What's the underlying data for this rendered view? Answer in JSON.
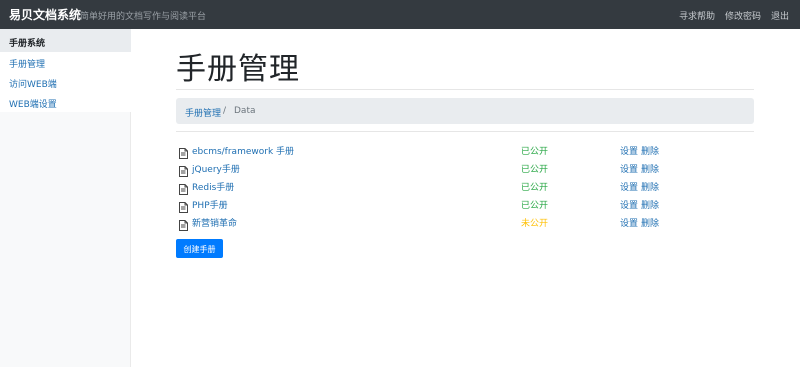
{
  "header": {
    "brand": "易贝文档系统",
    "tagline": "简单好用的文档写作与阅读平台",
    "nav": [
      "寻求帮助",
      "修改密码",
      "退出"
    ]
  },
  "sidebar": {
    "title": "手册系统",
    "items": [
      {
        "label": "手册管理"
      },
      {
        "label": "访问WEB端"
      },
      {
        "label": "WEB端设置"
      }
    ]
  },
  "main": {
    "title": "手册管理",
    "breadcrumb": {
      "link": "手册管理",
      "separator": "/",
      "current": "Data"
    },
    "manuals": [
      {
        "name": "ebcms/framework 手册",
        "status": "已公开",
        "status_color": "#28a745",
        "actions": [
          "设置",
          "删除"
        ]
      },
      {
        "name": "jQuery手册",
        "status": "已公开",
        "status_color": "#28a745",
        "actions": [
          "设置",
          "删除"
        ]
      },
      {
        "name": "Redis手册",
        "status": "已公开",
        "status_color": "#28a745",
        "actions": [
          "设置",
          "删除"
        ]
      },
      {
        "name": "PHP手册",
        "status": "已公开",
        "status_color": "#28a745",
        "actions": [
          "设置",
          "删除"
        ]
      },
      {
        "name": "新营销革命",
        "status": "未公开",
        "status_color": "#ffc107",
        "actions": [
          "设置",
          "删除"
        ]
      }
    ],
    "create_button": "创建手册"
  },
  "colors": {
    "topbar": "#343a40",
    "link": "#1f6fb2",
    "primary_button": "#007bff",
    "public": "#28a745",
    "private": "#ffc107"
  },
  "icons": {
    "manual_row": "document-icon"
  }
}
